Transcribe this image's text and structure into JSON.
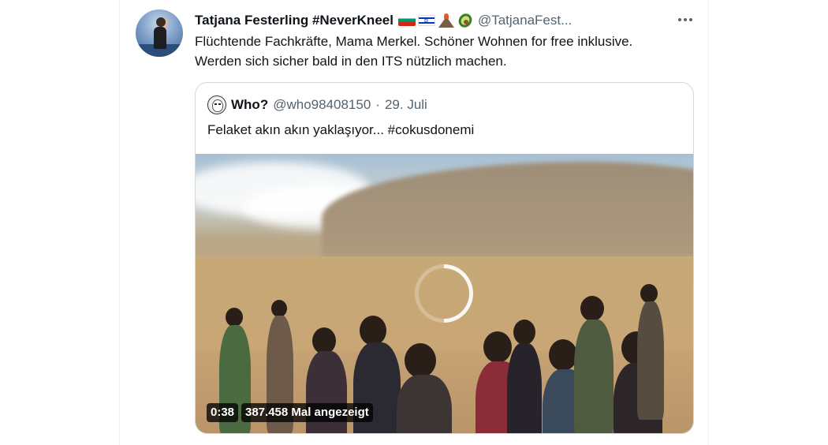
{
  "tweet": {
    "display_name": "Tatjana Festerling #NeverKneel",
    "handle": "@TatjanaFest...",
    "name_emojis": [
      "flag-bulgaria-icon",
      "flag-israel-icon",
      "volcano-icon",
      "avocado-icon"
    ],
    "text_lines": [
      "Flüchtende Fachkräfte, Mama Merkel. Schöner Wohnen for free inklusive.",
      "Werden sich sicher bald in den ITS nützlich machen."
    ]
  },
  "quoted": {
    "display_name": "Who?",
    "handle": "@who98408150",
    "separator": "·",
    "date": "29. Juli",
    "text": "Felaket akın akın yaklaşıyor... #cokusdonemi",
    "video": {
      "duration": "0:38",
      "views": "387.458 Mal angezeigt"
    }
  },
  "colors": {
    "text_primary": "#0f1419",
    "text_secondary": "#536471",
    "border": "#cfd9de"
  }
}
